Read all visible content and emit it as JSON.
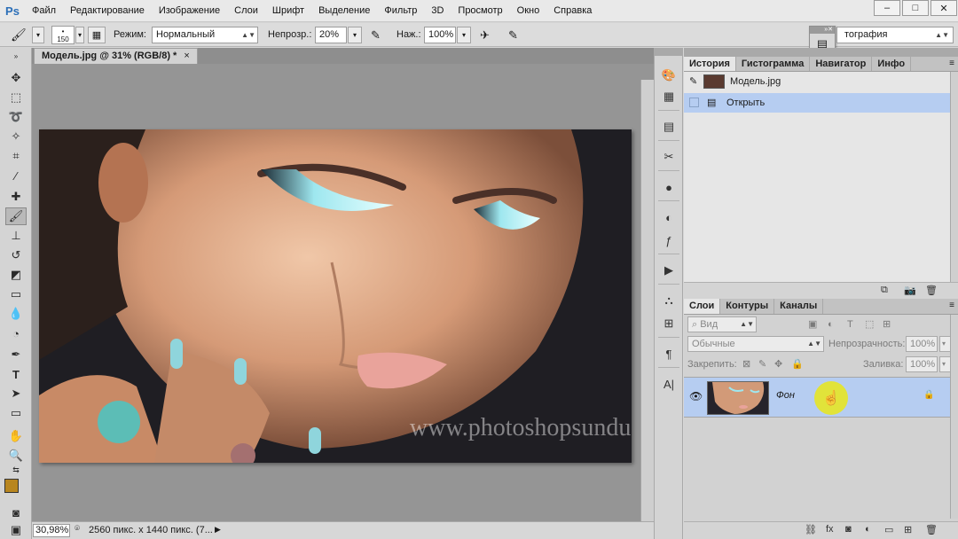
{
  "app": {
    "logo": "Ps"
  },
  "menu": [
    "Файл",
    "Редактирование",
    "Изображение",
    "Слои",
    "Шрифт",
    "Выделение",
    "Фильтр",
    "3D",
    "Просмотр",
    "Окно",
    "Справка"
  ],
  "window_controls": {
    "minimize": "–",
    "maximize": "□",
    "close": "✕"
  },
  "options": {
    "brush_size": "150",
    "mode_label": "Режим:",
    "mode_value": "Нормальный",
    "opacity_label": "Непрозр.:",
    "opacity_value": "20%",
    "pressure_label": "Наж.:",
    "pressure_value": "100%",
    "workspace": "тография"
  },
  "document": {
    "tab_title": "Модель.jpg @ 31% (RGB/8) *",
    "close": "×",
    "zoom": "30,98%",
    "info": "2560 пикс. x 1440 пикс. (7...",
    "watermark": "www.photoshopsunduchok.ru"
  },
  "history_panel": {
    "tabs": [
      "История",
      "Гистограмма",
      "Навигатор",
      "Инфо"
    ],
    "snapshot": "Модель.jpg",
    "items": [
      "Открыть"
    ]
  },
  "layers_panel": {
    "tabs": [
      "Слои",
      "Контуры",
      "Каналы"
    ],
    "filter_kind": "Вид",
    "blend_mode": "Обычные",
    "opacity_label": "Непрозрачность:",
    "opacity_value": "100%",
    "lock_label": "Закрепить:",
    "fill_label": "Заливка:",
    "fill_value": "100%",
    "layers": [
      {
        "name": "Фон"
      }
    ]
  },
  "colors": {
    "foreground": "#b8861f",
    "background": "#ffffff",
    "selection": "#b6cdf1"
  }
}
